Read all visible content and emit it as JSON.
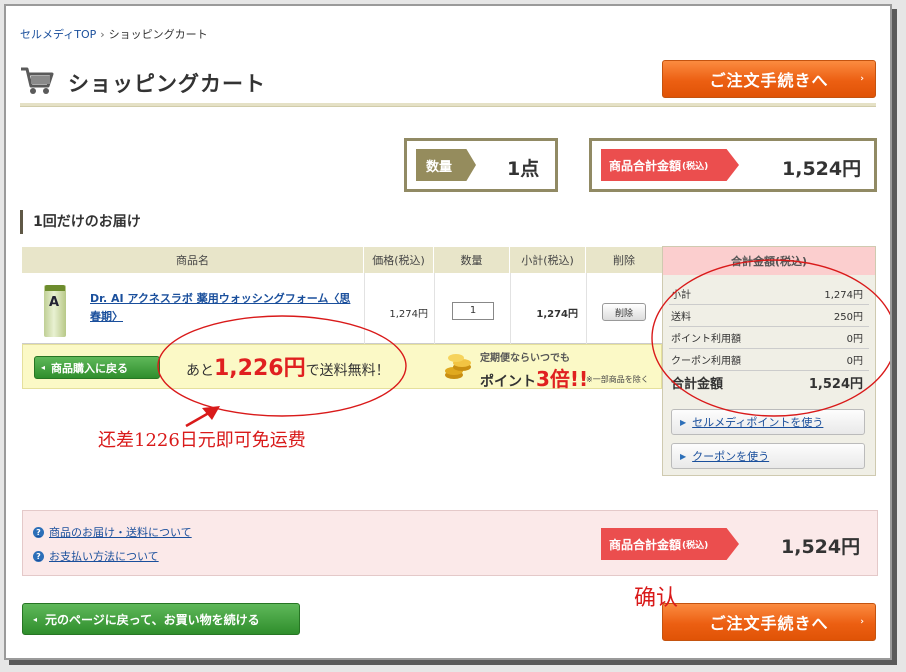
{
  "breadcrumb": {
    "home": "セルメディTOP",
    "separator": "›",
    "current": "ショッピングカート"
  },
  "page": {
    "title": "ショッピングカート"
  },
  "order_button": {
    "label": "ご注文手続きへ",
    "arrow": "›"
  },
  "summary_boxes": {
    "quantity_label": "数量",
    "quantity_value": "1点",
    "total_label": "商品合計金額",
    "total_tax": "(税込)",
    "total_value": "1,524円"
  },
  "section": {
    "heading": "1回だけのお届け"
  },
  "table": {
    "headers": [
      "商品名",
      "価格(税込)",
      "数量",
      "小計(税込)",
      "削除"
    ],
    "item": {
      "name": "Dr. AI アクネスラボ 薬用ウォッシングフォーム〈思春期〉",
      "image_letter": "A",
      "price": "1,274円",
      "quantity": "1",
      "subtotal": "1,274円",
      "delete_label": "削除"
    }
  },
  "promo": {
    "back_label": "商品購入に戻る",
    "remain_prefix": "あと",
    "remain_amount": "1,226円",
    "remain_suffix": "で送料無料！",
    "teiki_line1": "定期便ならいつでも",
    "teiki_prefix": "ポイント",
    "teiki_multiplier": "3倍!!",
    "teiki_note": "※一部商品を除く"
  },
  "totals_panel": {
    "heading": "合計金額(税込)",
    "rows": [
      {
        "label": "小計",
        "value": "1,274円"
      },
      {
        "label": "送料",
        "value": "250円"
      },
      {
        "label": "ポイント利用額",
        "value": "0円"
      },
      {
        "label": "クーポン利用額",
        "value": "0円"
      }
    ],
    "total_label": "合計金額",
    "total_value": "1,524円",
    "point_link": "セルメディポイントを使う",
    "coupon_link": "クーポンを使う"
  },
  "footer": {
    "help_delivery": "商品のお届け・送料について",
    "help_payment": "お支払い方法について",
    "total_label": "商品合計金額",
    "total_tax": "(税込)",
    "total_value": "1,524円"
  },
  "continue_button": {
    "label": "元のページに戻って、お買い物を続ける"
  },
  "annotations": {
    "free_shipping_note": "还差1226日元即可免运费",
    "confirm_note": "确认",
    "color": "#d91a1a"
  }
}
